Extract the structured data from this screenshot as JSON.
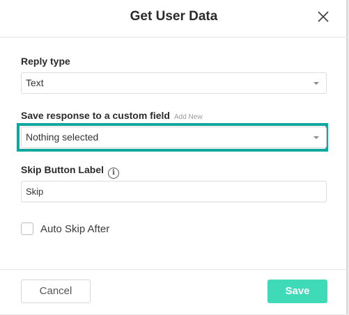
{
  "modal": {
    "title": "Get User Data"
  },
  "reply_type": {
    "label": "Reply type",
    "value": "Text"
  },
  "custom_field": {
    "label": "Save response to a custom field",
    "add_new": "Add New",
    "value": "Nothing selected",
    "highlight_color": "#0fa79e"
  },
  "skip_button": {
    "label": "Skip Button Label",
    "info_icon": "i",
    "value": "Skip"
  },
  "auto_skip": {
    "label": "Auto Skip After",
    "checked": false
  },
  "footer": {
    "cancel_label": "Cancel",
    "save_label": "Save",
    "save_color": "#3fdab8"
  }
}
